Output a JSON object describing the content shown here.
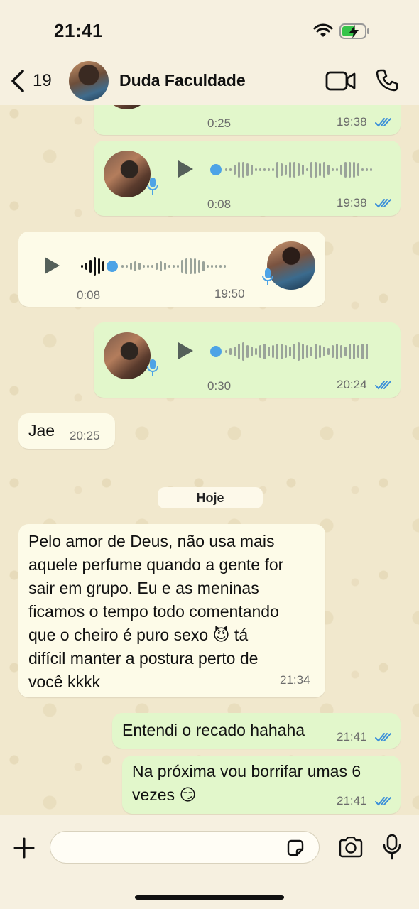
{
  "status": {
    "time": "21:41"
  },
  "header": {
    "back_count": "19",
    "contact_name": "Duda Faculdade"
  },
  "messages": [
    {
      "type": "audio",
      "direction": "out",
      "duration": "0:25",
      "time": "19:38"
    },
    {
      "type": "audio",
      "direction": "out",
      "duration": "0:08",
      "time": "19:38"
    },
    {
      "type": "audio",
      "direction": "in",
      "duration": "0:08",
      "time": "19:50"
    },
    {
      "type": "audio",
      "direction": "out",
      "duration": "0:30",
      "time": "20:24"
    },
    {
      "type": "text",
      "direction": "in",
      "text": "Jae",
      "time": "20:25"
    },
    {
      "type": "date",
      "label": "Hoje"
    },
    {
      "type": "text",
      "direction": "in",
      "lines": [
        "Pelo amor de Deus, não usa mais",
        "aquele perfume quando a gente for",
        "sair em grupo. Eu e as meninas",
        "ficamos o tempo todo comentando",
        "que o cheiro é puro sexo 😈 tá",
        "difícil manter a postura perto de",
        "você kkkk"
      ],
      "time": "21:34"
    },
    {
      "type": "text",
      "direction": "out",
      "text": "Entendi o recado hahaha",
      "time": "21:41"
    },
    {
      "type": "text",
      "direction": "out",
      "lines": [
        "Na próxima vou borrifar umas 6",
        "vezes 😏"
      ],
      "time": "21:41"
    }
  ],
  "colors": {
    "outgoing_bubble": "#e2f7cb",
    "incoming_bubble": "#fdfbe8",
    "read_ticks": "#3b8fd9",
    "wallpaper": "#f1e8cd"
  },
  "icons": [
    "back-chevron-icon",
    "video-call-icon",
    "phone-icon",
    "play-icon",
    "mic-icon",
    "plus-icon",
    "sticker-icon",
    "camera-icon",
    "wifi-icon",
    "battery-charging-icon",
    "double-check-icon"
  ]
}
